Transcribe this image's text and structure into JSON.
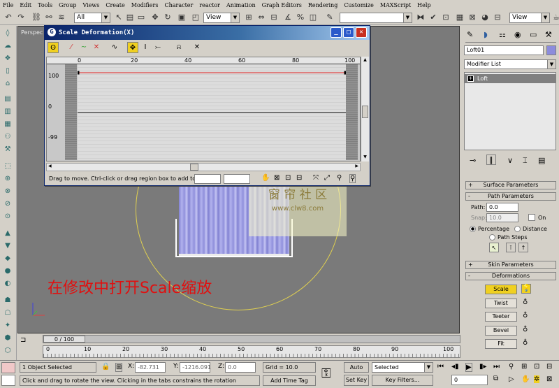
{
  "menu": [
    "File",
    "Edit",
    "Tools",
    "Group",
    "Views",
    "Create",
    "Modifiers",
    "Character",
    "reactor",
    "Animation",
    "Graph Editors",
    "Rendering",
    "Customize",
    "MAXScript",
    "Help"
  ],
  "toolbar": {
    "filter_value": "All",
    "ref_coord_value": "View",
    "named_sel_value": "",
    "viewport_layout_value": "View"
  },
  "viewport": {
    "label": "Perspec",
    "overlay_text": "在修改中打开Scale缩放",
    "watermark_line1": "窗 帘 社 区",
    "watermark_line2": "www.clw8.com"
  },
  "dialog": {
    "title": "Scale Deformation(X)",
    "ruler_ticks": [
      "0",
      "20",
      "40",
      "60",
      "80",
      "100"
    ],
    "y_labels": [
      "100",
      "0",
      "-99"
    ],
    "status_text": "Drag to move. Ctrl-click or drag region box to add to sel",
    "field1": "",
    "field2": ""
  },
  "command_panel": {
    "object_name": "Loft01",
    "modifier_list_label": "Modifier List",
    "stack_item": "Loft",
    "rollouts": {
      "surface": "Surface Parameters",
      "path": "Path Parameters",
      "skin": "Skin Parameters",
      "deformations": "Deformations"
    },
    "path_label": "Path:",
    "path_value": "0.0",
    "snap_label": "Snap:",
    "snap_value": "10.0",
    "on_label": "On",
    "percentage_label": "Percentage",
    "distance_label": "Distance",
    "path_steps_label": "Path Steps",
    "deform_buttons": [
      "Scale",
      "Twist",
      "Teeter",
      "Bevel",
      "Fit"
    ]
  },
  "timeline": {
    "frame_label": "0 / 100",
    "ticks": [
      "0",
      "10",
      "20",
      "30",
      "40",
      "50",
      "60",
      "70",
      "80",
      "90",
      "100"
    ]
  },
  "status": {
    "selection": "1 Object Selected",
    "prompt": "Click and drag to rotate the view.  Clicking in the tabs constrains the rotation",
    "x_label": "X:",
    "x_value": "-82.731",
    "y_label": "Y:",
    "y_value": "-1216.091",
    "z_label": "Z:",
    "z_value": "0.0",
    "grid": "Grid = 10.0",
    "add_time_tag": "Add Time Tag",
    "auto_key": "Auto Key",
    "set_key": "Set Key",
    "selected_value": "Selected",
    "key_filters": "Key Filters...",
    "frame_value": "0"
  },
  "chart_data": {
    "type": "line",
    "title": "Scale Deformation(X)",
    "x": [
      0,
      100
    ],
    "series": [
      {
        "values": [
          100,
          100
        ]
      }
    ],
    "xlim": [
      0,
      100
    ],
    "ylim": [
      -99,
      100
    ]
  }
}
